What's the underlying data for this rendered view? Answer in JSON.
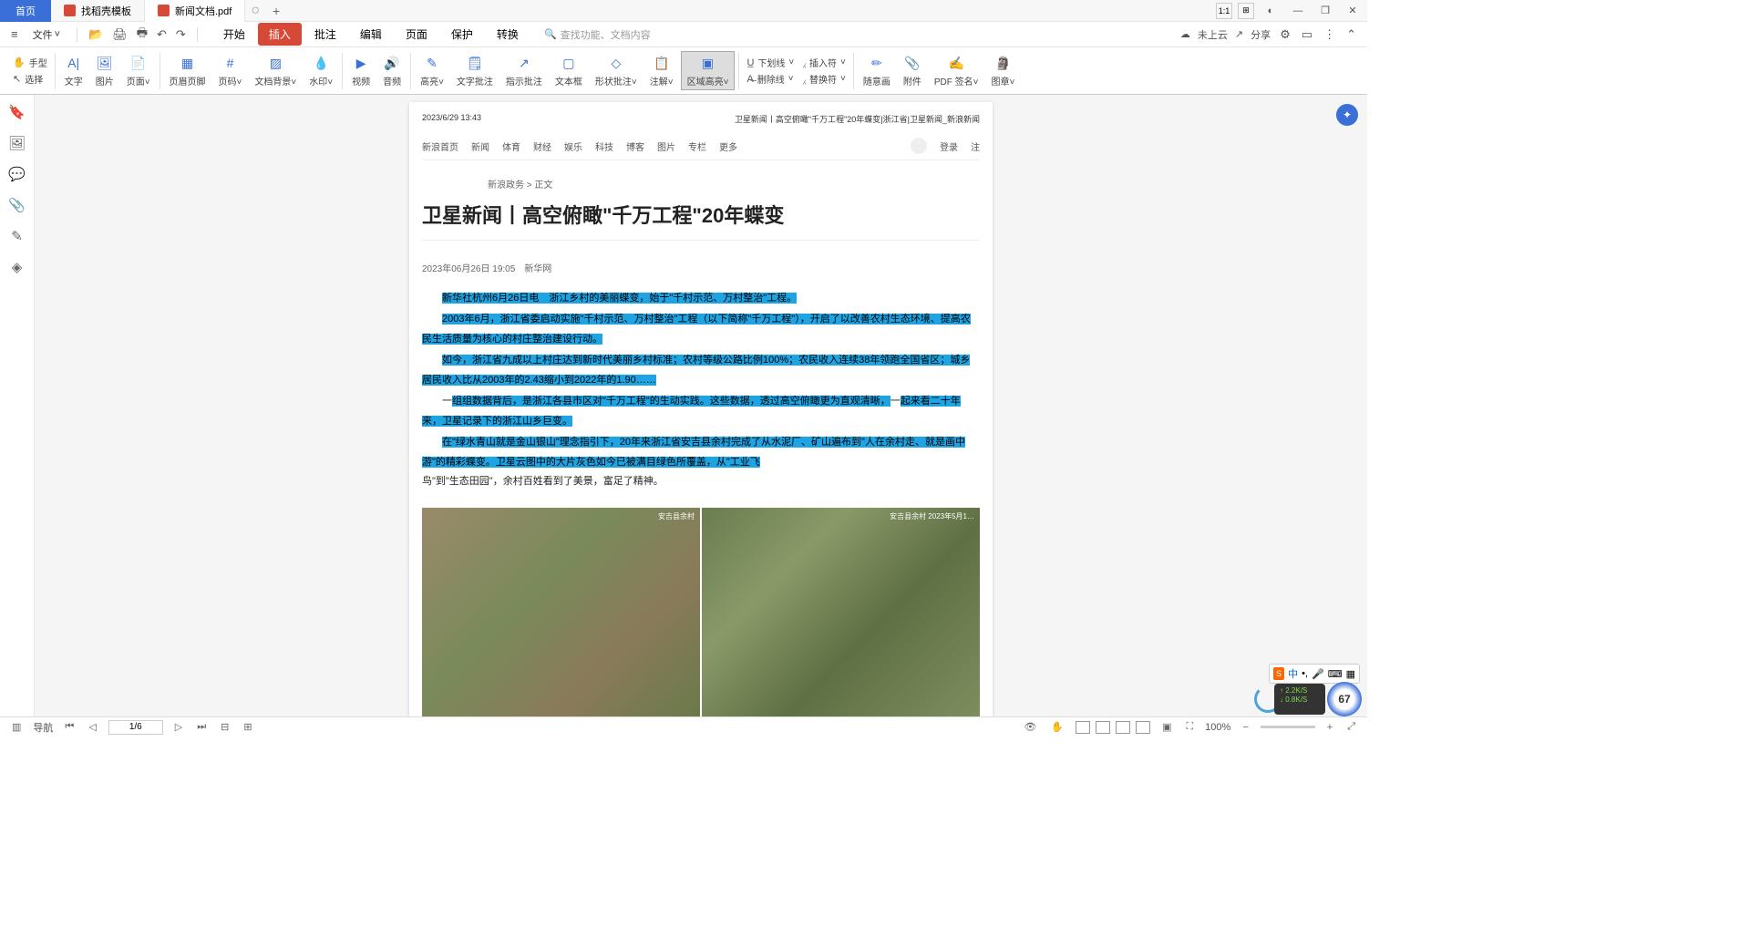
{
  "titlebar": {
    "home": "首页",
    "tabs": [
      {
        "label": "找稻壳模板",
        "icon": "red"
      },
      {
        "label": "新闻文档.pdf",
        "icon": "pdf",
        "active": true
      }
    ],
    "closeIcon": "○",
    "plus": "+"
  },
  "menubar": {
    "file": "文件",
    "tabs": [
      "开始",
      "插入",
      "批注",
      "编辑",
      "页面",
      "保护",
      "转换"
    ],
    "activeTab": 1,
    "search": "查找功能、文档内容",
    "cloud": "未上云",
    "share": "分享"
  },
  "ribbon": {
    "hand": "手型",
    "select": "选择",
    "items": [
      "文字",
      "图片",
      "页面",
      "页眉页脚",
      "页码",
      "文档背景",
      "水印",
      "视频",
      "音频",
      "高亮",
      "文字批注",
      "指示批注",
      "文本框",
      "形状批注",
      "注解",
      "区域高亮"
    ],
    "right": [
      {
        "l": "下划线"
      },
      {
        "l": "插入符"
      },
      {
        "l": "删除线"
      },
      {
        "l": "替换符"
      }
    ],
    "far": [
      "随意画",
      "附件",
      "PDF 签名",
      "图章"
    ]
  },
  "lefttools": [
    "bookmark",
    "image",
    "comment",
    "attach",
    "stamp",
    "layers"
  ],
  "doc": {
    "ts": "2023/6/29 13:43",
    "title": "卫星新闻丨高空俯瞰\"千万工程\"20年蝶变|浙江省|卫星新闻_新浪新闻",
    "nav": [
      "新浪首页",
      "新闻",
      "体育",
      "财经",
      "娱乐",
      "科技",
      "博客",
      "图片",
      "专栏",
      "更多"
    ],
    "login": "登录",
    "reg": "注",
    "crumb": "新浪政务 > 正文",
    "headline": "卫星新闻丨高空俯瞰\"千万工程\"20年蝶变",
    "date": "2023年06月26日 19:05",
    "source": "新华网",
    "p1": "新华社杭州6月26日电　浙江乡村的美丽蝶变，始于\"千村示范、万村整治\"工程。",
    "p2": "2003年6月，浙江省委启动实施\"千村示范、万村整治\"工程（以下简称\"千万工程\"），开启了以改善农村生态环境、提高农民生活质量为核心的村庄整治建设行动。",
    "p3": "如今，浙江省九成以上村庄达到新时代美丽乡村标准；农村等级公路比例100%；农民收入连续38年领跑全国省区；城乡居民收入比从2003年的2.43缩小到2022年的1.90……",
    "p4a": "一",
    "p4b": "组组数据背后，是浙江各县市区对\"千万工程\"的生动实践。这些数据，透过高空俯瞰更为直观清晰，",
    "p4c": "一",
    "p4d": "起来看二十年来，卫星记录下的浙江山乡巨变。",
    "p5": "在\"绿水青山就是金山银山\"理念指引下，20年来浙江省安吉县余村完成了从水泥厂、矿山遍布到\"人在余村走、就是画中游\"的精彩蝶变。卫星云图中的大片灰色如今已被满目绿色所覆盖，从\"工业飞",
    "p5tail": "鸟\"到\"生态田园\"，余村百姓看到了美景，富足了精神。",
    "sat1": "安吉县余村",
    "sat2": "安吉县余村\n2023年5月1…"
  },
  "status": {
    "nav": "导航",
    "page": "1/6",
    "zoom": "100%"
  },
  "float": {
    "sogou": "中",
    "net1": "2.2K/S",
    "net2": "0.8K/S",
    "circ": "67"
  }
}
